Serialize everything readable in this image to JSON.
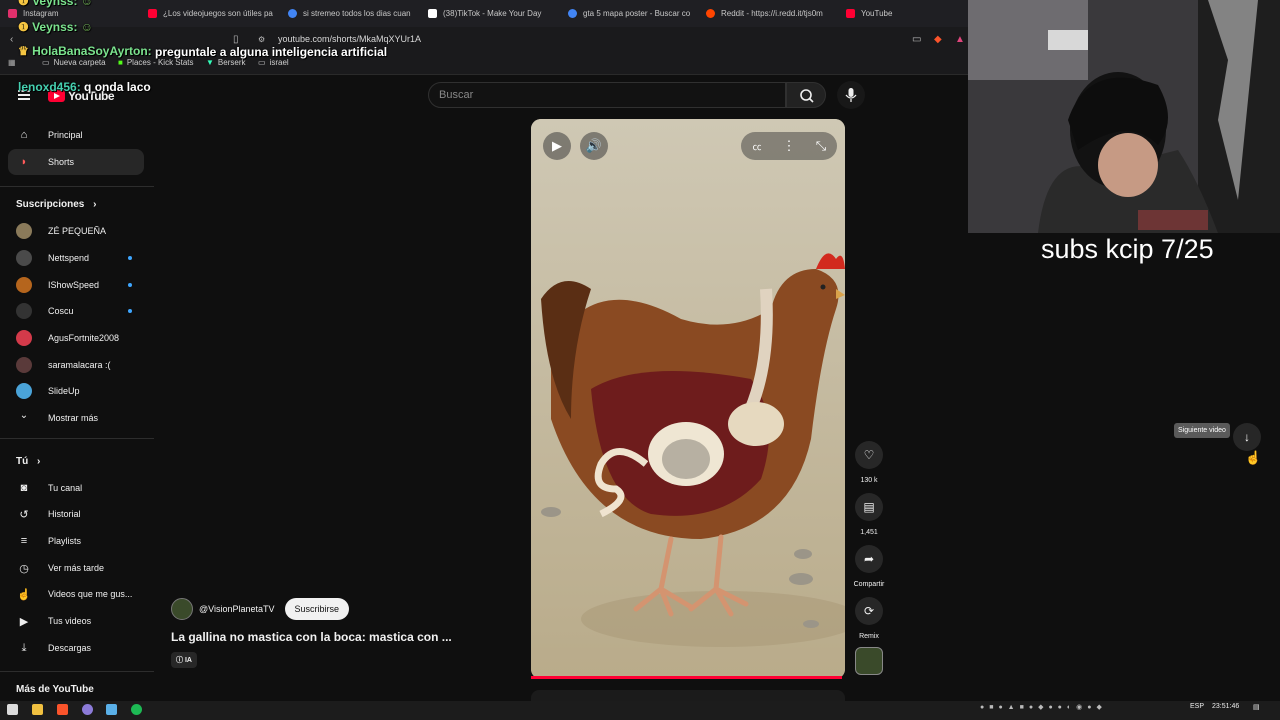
{
  "browser": {
    "tabs": [
      {
        "label": "Instagram",
        "color": "#e1306c"
      },
      {
        "label": "¿Los videojuegos son útiles pa",
        "color": "#ff0033"
      },
      {
        "label": "si stremeo todos los dias cuan",
        "color": "#4285f4"
      },
      {
        "label": "(38)TikTok - Make Your Day",
        "color": "#ffffff"
      },
      {
        "label": "gta 5 mapa poster - Buscar co",
        "color": "#4285f4"
      },
      {
        "label": "Reddit - https://i.redd.it/tjs0m",
        "color": "#ff4500"
      },
      {
        "label": "YouTube",
        "color": "#ff0033"
      }
    ],
    "url": "youtube.com/shorts/MkaMqXYUr1A",
    "bookmarks": [
      "Nueva carpeta",
      "Places - Kick Stats",
      "Berserk",
      "israel"
    ]
  },
  "chat": [
    {
      "user": "Veynss:",
      "message": "",
      "color": "#7be38e"
    },
    {
      "user": "Veynss:",
      "message": "",
      "color": "#7be38e"
    },
    {
      "user": "HolaBanaSoyAyrton:",
      "message": "preguntale a alguna inteligencia artificial",
      "color": "#7be38e"
    },
    {
      "user": "lenoxd456:",
      "message": "q onda laco",
      "color": "#45d0b0"
    }
  ],
  "youtube": {
    "logo_text": "YouTube",
    "search_placeholder": "Buscar",
    "nav": [
      {
        "label": "Principal",
        "icon": "home-icon"
      },
      {
        "label": "Shorts",
        "icon": "shorts-icon"
      }
    ],
    "subscriptions_title": "Suscripciones",
    "subscriptions": [
      {
        "name": "ZÉ PEQUEÑA",
        "color": "#8a7a5a",
        "new": false
      },
      {
        "name": "Nettspend",
        "color": "#4a4a4a",
        "new": true
      },
      {
        "name": "IShowSpeed",
        "color": "#b5651d",
        "new": true
      },
      {
        "name": "Coscu",
        "color": "#333333",
        "new": true
      },
      {
        "name": "AgusFortnite2008",
        "color": "#d33a4a",
        "new": false
      },
      {
        "name": "saramalacara :(",
        "color": "#5a3a3a",
        "new": false
      },
      {
        "name": "SlideUp",
        "color": "#4aa3d8",
        "new": false
      }
    ],
    "show_more": "Mostrar más",
    "you_title": "Tú",
    "you_items": [
      {
        "label": "Tu canal",
        "icon": "channel-icon"
      },
      {
        "label": "Historial",
        "icon": "history-icon"
      },
      {
        "label": "Playlists",
        "icon": "playlists-icon"
      },
      {
        "label": "Ver más tarde",
        "icon": "watch-later-icon"
      },
      {
        "label": "Videos que me gus...",
        "icon": "liked-icon"
      },
      {
        "label": "Tus videos",
        "icon": "your-videos-icon"
      },
      {
        "label": "Descargas",
        "icon": "downloads-icon"
      }
    ],
    "more_title": "Más de YouTube"
  },
  "short": {
    "channel": "@VisionPlanetaTV",
    "subscribe_label": "Suscribirse",
    "title": "La gallina no mastica con la boca: mastica con ...",
    "badge": "IA",
    "likes": "130 k",
    "comments": "1,451",
    "share_label": "Compartir",
    "remix_label": "Remix",
    "next_tooltip": "Siguiente video",
    "progress": 0.99
  },
  "stream": {
    "overlay_text": "subs kcip 7/25"
  },
  "taskbar": {
    "language": "ESP",
    "clock": "23:51:46"
  }
}
